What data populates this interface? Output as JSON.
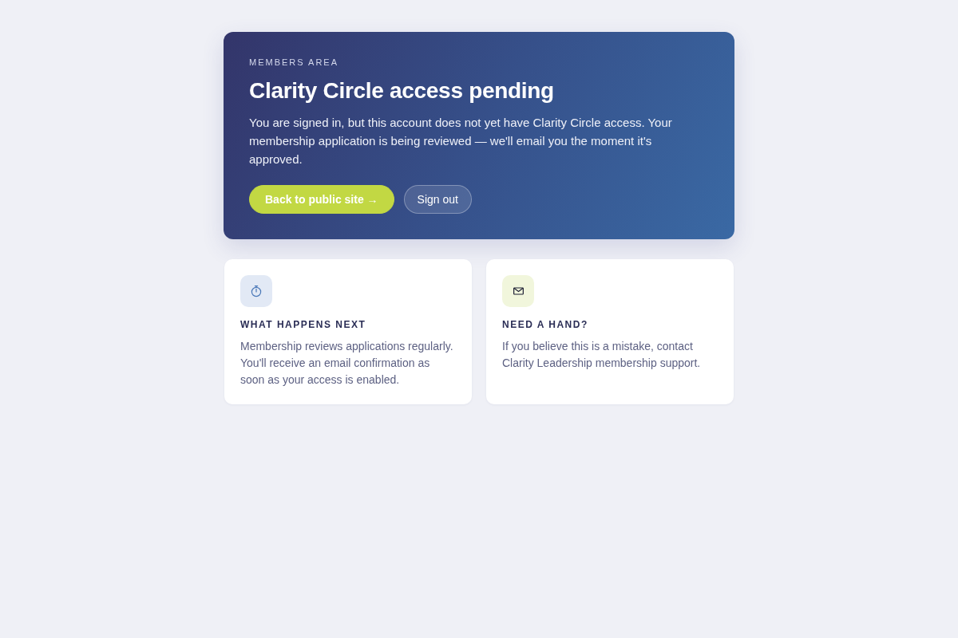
{
  "hero": {
    "eyebrow": "MEMBERS AREA",
    "title": "Clarity Circle access pending",
    "message": "You are signed in, but this account does not yet have Clarity Circle access. Your membership application is being reviewed — we'll email you the moment it's approved.",
    "buttons": [
      {
        "label": "Back to public site →",
        "kind": "primary"
      },
      {
        "label": "Sign out",
        "kind": "secondary"
      }
    ]
  },
  "cards": [
    {
      "kind": "timer",
      "heading": "WHAT HAPPENS NEXT",
      "text": "Membership reviews applications regularly. You'll receive an email confirmation as soon as your access is enabled."
    },
    {
      "kind": "mail",
      "heading": "NEED A HAND?",
      "text": "If you believe this is a mistake, contact Clarity Leadership membership support."
    }
  ]
}
